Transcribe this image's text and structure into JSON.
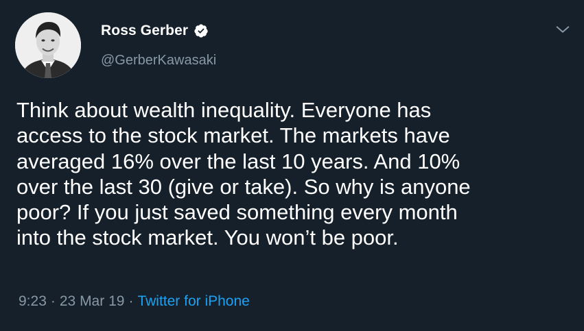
{
  "author": {
    "display_name": "Ross Gerber",
    "handle": "@GerberKawasaki",
    "verified": true
  },
  "tweet": {
    "text": "Think about wealth inequality. Everyone has\naccess to the stock market. The markets have\naveraged 16% over the last 10 years. And 10%\nover the last 30 (give or take). So why is anyone\npoor? If you just saved something every month\ninto the stock market. You won’t be poor."
  },
  "meta": {
    "time": "9:23",
    "separator": "·",
    "date": "23 Mar 19",
    "source": "Twitter for iPhone"
  },
  "icons": {
    "menu": "chevron-down-icon",
    "verified": "verified-badge-icon"
  },
  "colors": {
    "background": "#15202b",
    "text": "#ffffff",
    "secondary": "#8899a6",
    "accent": "#1da1f2"
  }
}
